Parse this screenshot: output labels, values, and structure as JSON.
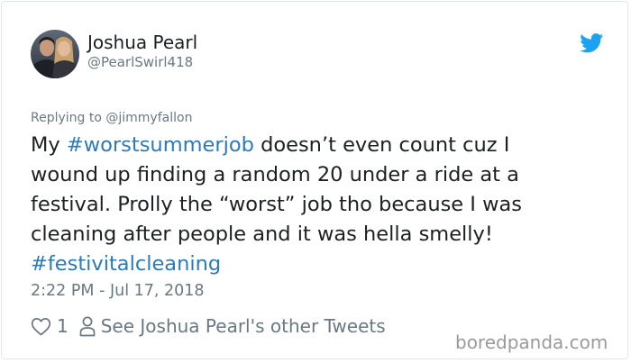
{
  "author": {
    "name": "Joshua Pearl",
    "handle": "@PearlSwirl418"
  },
  "replying_to": "Replying to @jimmyfallon",
  "tweet": {
    "lines": [
      [
        "My ",
        "#worstsummerjob",
        " doesn’t even count cuz I"
      ],
      [
        "wound up finding a random 20 under a ride at a"
      ],
      [
        "festival. Prolly the “worst” job tho because I was"
      ],
      [
        "cleaning after people and it was hella smelly!"
      ],
      [
        "#festivitalcleaning"
      ]
    ],
    "hashtag_color": "#2b7bb9"
  },
  "timestamp": "2:22 PM - Jul 17, 2018",
  "actions": {
    "like_icon": "heart-icon",
    "like_count": "1",
    "person_icon": "person-icon",
    "see_other_label": "See Joshua Pearl's other Tweets"
  },
  "watermark": "boredpanda.com",
  "colors": {
    "text": "#1c2022",
    "muted": "#697882",
    "twitter_blue": "#1da1f2",
    "border": "#e1e8ed"
  }
}
